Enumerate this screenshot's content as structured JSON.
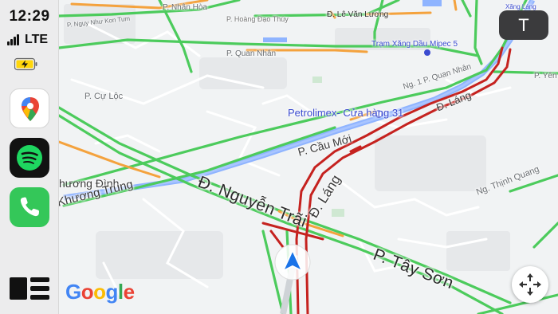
{
  "status": {
    "time": "12:29",
    "network": "LTE",
    "battery_state": "charging"
  },
  "sidebar": {
    "apps": [
      {
        "name": "Google Maps",
        "icon": "google-maps-icon"
      },
      {
        "name": "Spotify",
        "icon": "spotify-icon"
      },
      {
        "name": "Phone",
        "icon": "phone-icon"
      }
    ],
    "dashboard_icon": "dashboard-icon"
  },
  "map": {
    "major_labels": {
      "nguyen_trai": "Đ. Nguyễn Trãi",
      "tay_son": "P. Tây Sơn",
      "lang_diag": "Đ. Láng",
      "lang_top": "Đ. Láng",
      "cau_moi": "P. Cầu Mới",
      "khuong_dinh": "hương Đình",
      "khuong_trung": "Khương Trung"
    },
    "minor_labels": {
      "cu_loc": "P. Cự Lộc",
      "quan_nhan_top": "P. Quan Nhân",
      "quan_nhan_ng": "Ng. 1 P. Quan Nhân",
      "le_van_luong": "Đ. Lê Văn Lương",
      "hoang_dao_thuy": "P. Hoàng Đạo Thúy",
      "nhan_hoa": "P. Nhân Hòa",
      "thinh_quang": "Ng. Thịnh Quang",
      "yen": "P. Yên",
      "nguy_nhu": "P. Ngụy Như Kon Tum",
      "xang_lang": "Xăng Láng"
    },
    "poi": {
      "petrolimex": "Petrolimex- Cửa hàng 31",
      "tram_xang": "Trạm Xăng Dầu Mipec 5"
    },
    "colors": {
      "traffic_free": "#4ccb5c",
      "traffic_slow": "#f4a23d",
      "traffic_heavy": "#c5221f",
      "river": "#8fb4ff"
    }
  },
  "controls": {
    "profile_initial": "T",
    "recenter_icon": "recenter-icon",
    "logo": "Google"
  }
}
